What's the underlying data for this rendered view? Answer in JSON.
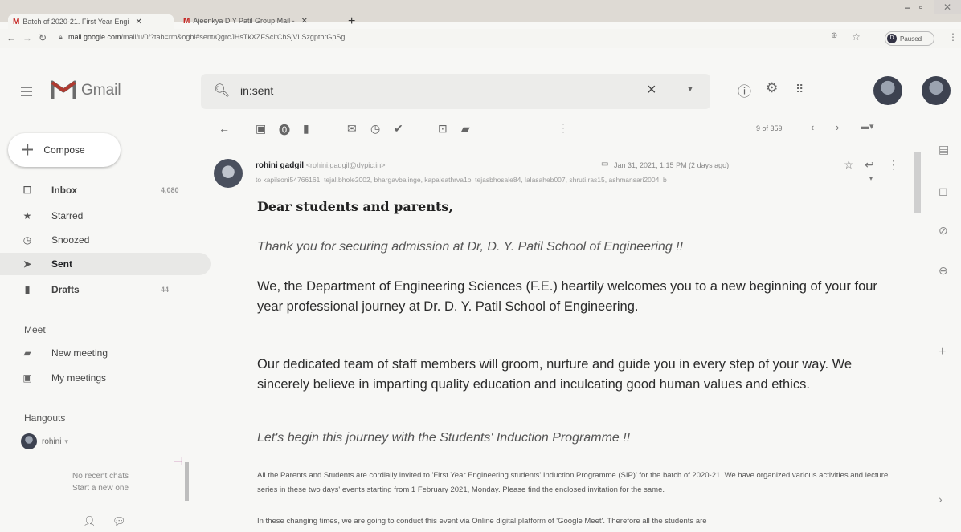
{
  "browser": {
    "tabs": [
      {
        "title": "Batch of 2020-21. First Year Engi",
        "active": true
      },
      {
        "title": "Ajeenkya D Y Patil Group Mail -",
        "active": false
      }
    ],
    "new_tab": "+",
    "url_host": "mail.google.com",
    "url_path": "/mail/u/0/?tab=rm&ogbl#sent/QgrcJHsTkXZFScltChSjVLSzgptbrGpSg",
    "profile_initial": "D",
    "profile_status": "Paused"
  },
  "gmail": {
    "app_name": "Gmail",
    "search": {
      "value": "in:sent"
    },
    "compose_label": "Compose",
    "nav": [
      {
        "icon": "inbox-icon",
        "label": "Inbox",
        "count": "4,080"
      },
      {
        "icon": "star-icon",
        "label": "Starred",
        "count": ""
      },
      {
        "icon": "clock-icon",
        "label": "Snoozed",
        "count": ""
      },
      {
        "icon": "send-icon",
        "label": "Sent",
        "count": ""
      },
      {
        "icon": "draft-icon",
        "label": "Drafts",
        "count": "44"
      }
    ],
    "meet": {
      "heading": "Meet",
      "new_meeting": "New meeting",
      "my_meetings": "My meetings"
    },
    "hangouts": {
      "heading": "Hangouts",
      "user": "rohini",
      "no_chats": "No recent chats",
      "start_new": "Start a new one"
    },
    "pager": "9 of 359"
  },
  "message": {
    "sender_name": "rohini gadgil",
    "sender_email": "<rohini.gadgil@dypic.in>",
    "recipients": "to kapilsoni54766161, tejal.bhole2002, bhargavbalinge, kapaleathrva1o, tejasbhosale84, lalasaheb007, shruti.ras15, ashmansari2004, b",
    "date": "Jan 31, 2021, 1:15 PM (2 days ago)",
    "greeting": "Dear students and parents,",
    "thanks": "Thank you for securing admission at Dr, D. Y. Patil School of Engineering !!",
    "para1": "We, the Department of Engineering Sciences (F.E.) heartily welcomes you to a new beginning of your four year professional journey at Dr. D. Y. Patil School of Engineering.",
    "para2": "Our dedicated team of staff members will groom, nurture and guide you in every step of your way. We sincerely believe in imparting quality education and inculcating good human values and ethics.",
    "begin": "Let's begin this journey with the Students' Induction Programme !!",
    "small1": "All the Parents and Students are cordially invited to 'First Year Engineering students' Induction Programme (SIP)' for the batch of 2020-21. We have organized various activities and lecture series in these two days' events starting from 1 February 2021, Monday. Please find the enclosed invitation for the same.",
    "small2": "In these changing times, we are going to conduct this event via Online digital platform of 'Google Meet'. Therefore all the students are"
  }
}
